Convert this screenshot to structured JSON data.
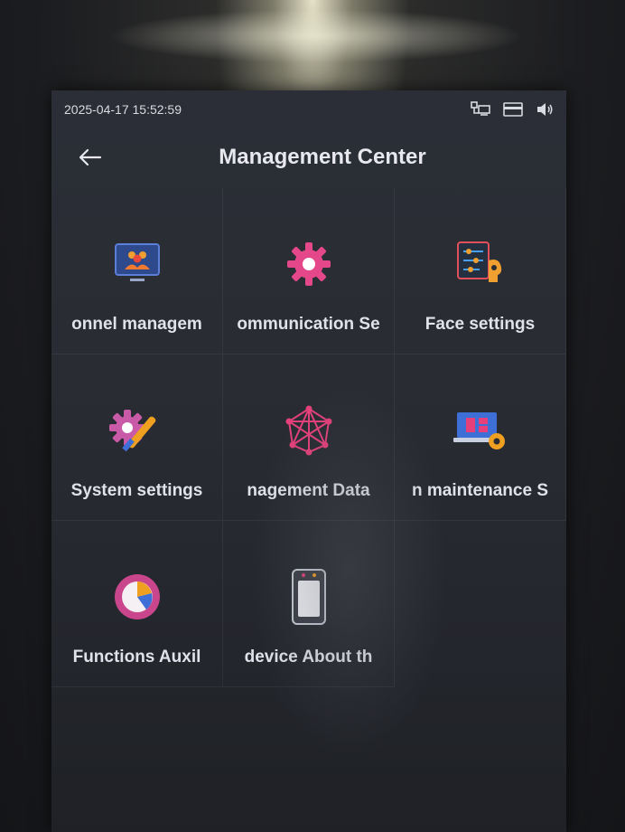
{
  "status_bar": {
    "datetime": "2025-04-17 15:52:59",
    "icons": [
      "network-icon",
      "card-icon",
      "volume-icon"
    ]
  },
  "header": {
    "title": "Management Center",
    "back_icon": "arrow-left-icon"
  },
  "tiles": [
    {
      "label": "onnel managem",
      "icon": "personnel-icon"
    },
    {
      "label": "ommunication Se",
      "icon": "gear-icon"
    },
    {
      "label": "Face settings",
      "icon": "face-settings-icon"
    },
    {
      "label": "System settings",
      "icon": "system-settings-icon"
    },
    {
      "label": "nagement Data",
      "icon": "network-data-icon"
    },
    {
      "label": "n maintenance S",
      "icon": "maintenance-icon"
    },
    {
      "label": "Functions Auxil",
      "icon": "pie-chart-icon"
    },
    {
      "label": "device About th",
      "icon": "device-icon"
    }
  ],
  "colors": {
    "screen_bg": "#2a2d34",
    "text": "#dfe2ea",
    "accent_pink": "#e84a8a",
    "accent_blue": "#3d6fd6",
    "accent_orange": "#f0a020"
  }
}
